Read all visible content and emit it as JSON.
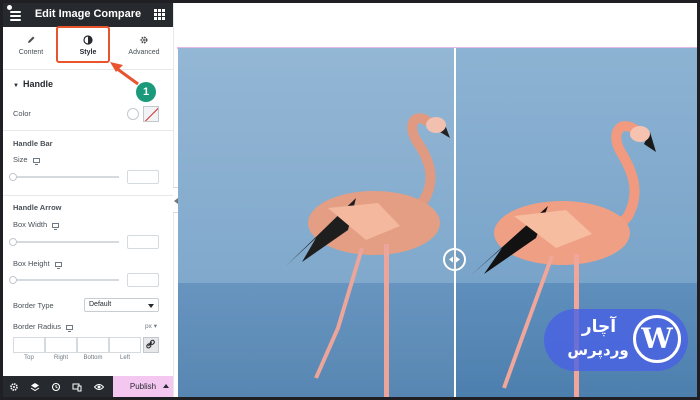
{
  "app": {
    "title": "Edit Image Compare"
  },
  "tabs": [
    {
      "label": "Content",
      "icon": "pencil-icon"
    },
    {
      "label": "Style",
      "icon": "half-circle-icon",
      "active": true
    },
    {
      "label": "Advanced",
      "icon": "gear-icon"
    }
  ],
  "handle_section": {
    "title": "Handle",
    "color_label": "Color",
    "handle_bar_title": "Handle Bar",
    "size_label": "Size",
    "handle_arrow_title": "Handle Arrow",
    "box_width_label": "Box Width",
    "box_height_label": "Box Height",
    "border_type_label": "Border Type",
    "border_type_value": "Default",
    "border_radius_label": "Border Radius",
    "border_radius_unit": "px",
    "dimension_labels": [
      "Top",
      "Right",
      "Bottom",
      "Left"
    ]
  },
  "bottombar": {
    "publish_label": "Publish"
  },
  "annotation": {
    "step_number": "1"
  },
  "watermark": {
    "line1": "آچار",
    "line2": "وردپرس",
    "logo_letter": "W"
  },
  "colors": {
    "accent": "#e8542e",
    "badge": "#1a9a7a",
    "publish_bg": "#f4c7f1",
    "topbar": "#26292e",
    "watermark": "#4860e6"
  }
}
